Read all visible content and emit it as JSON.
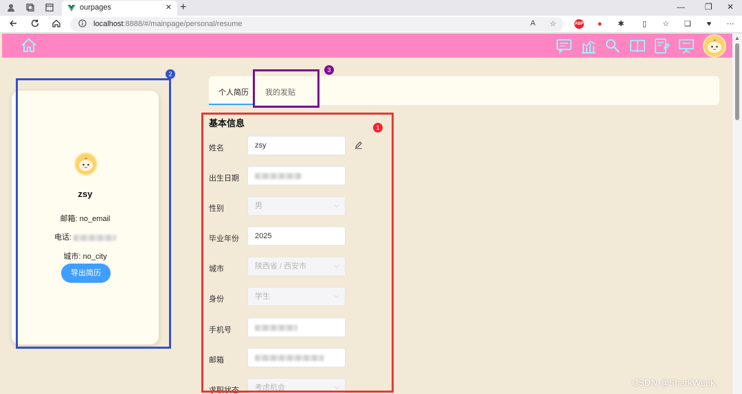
{
  "browser": {
    "tab_title": "ourpages",
    "tab_close": "✕",
    "new_tab": "+",
    "url_host": "localhost",
    "url_rest": ":8888/#/mainpage/personal/resume",
    "read_aloud": "A",
    "ext_abp": "ABP"
  },
  "app": {
    "accent": "#fe85c1",
    "primary": "#409eff"
  },
  "profile": {
    "name": "zsy",
    "email_label": "邮箱:",
    "email_value": "no_email",
    "phone_label": "电话:",
    "city_label": "城市:",
    "city_value": "no_city",
    "export_button": "导出简历",
    "badge": "2"
  },
  "tabs": {
    "items": [
      "个人简历",
      "我的发贴"
    ],
    "badge": "3"
  },
  "form": {
    "title": "基本信息",
    "badge": "1",
    "fields": {
      "name": {
        "label": "姓名",
        "value": "zsy"
      },
      "birth": {
        "label": "出生日期"
      },
      "gender": {
        "label": "性别",
        "value": "男"
      },
      "grad_year": {
        "label": "毕业年份",
        "value": "2025"
      },
      "city": {
        "label": "城市",
        "value": "陕西省 / 西安市"
      },
      "identity": {
        "label": "身份",
        "value": "学生"
      },
      "phone": {
        "label": "手机号"
      },
      "email": {
        "label": "邮箱"
      },
      "job_status": {
        "label": "求职状态",
        "value": "考虑机会"
      }
    }
  },
  "watermark": "CSDN @SharkWeek."
}
